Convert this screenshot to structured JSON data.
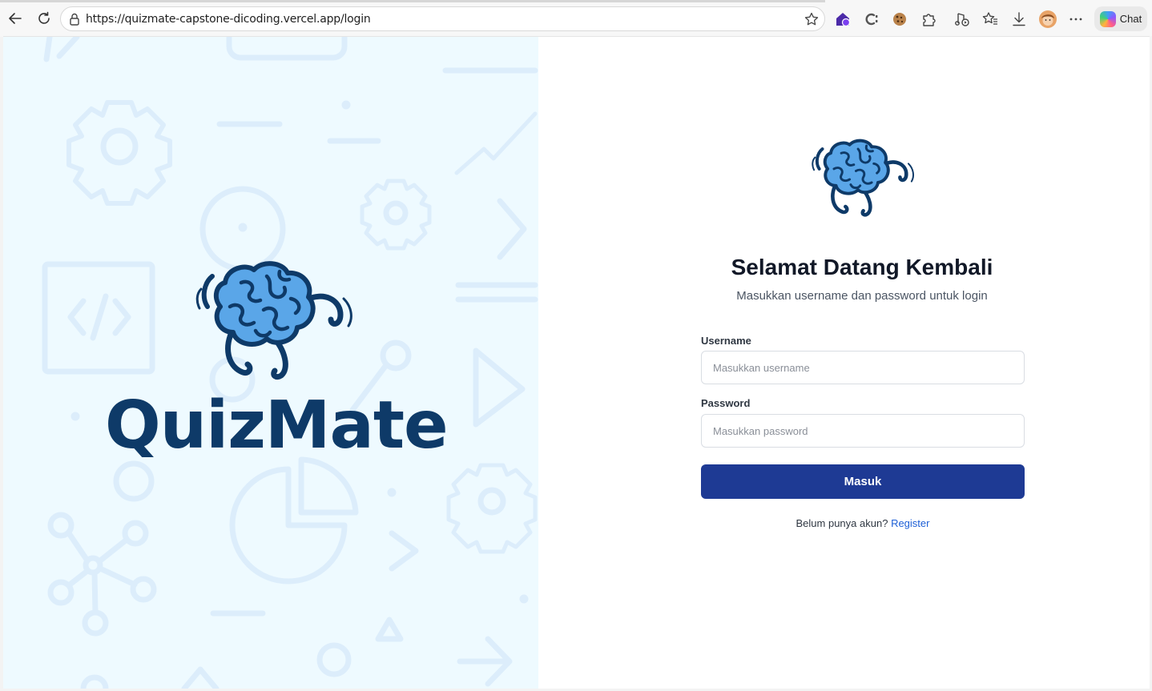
{
  "browser": {
    "url": "https://quizmate-capstone-dicoding.vercel.app/login",
    "chat_label": "Chat",
    "toolbar_icons": [
      "extension-house-icon",
      "extension-c-icon",
      "cookie-icon",
      "extensions-puzzle-icon",
      "media-control-icon",
      "favorites-icon",
      "downloads-icon",
      "profile-avatar-icon",
      "more-menu-icon"
    ]
  },
  "branding": {
    "name": "QuizMate"
  },
  "login": {
    "title": "Selamat Datang Kembali",
    "subtitle": "Masukkan username dan password untuk login",
    "username_label": "Username",
    "username_placeholder": "Masukkan username",
    "password_label": "Password",
    "password_placeholder": "Masukkan password",
    "submit_label": "Masuk",
    "register_prompt": "Belum punya akun?",
    "register_link": "Register"
  },
  "colors": {
    "accent": "#1e3a94",
    "link": "#1d5fd6",
    "brand_dark": "#0e3a68",
    "left_bg": "#eefaff"
  }
}
